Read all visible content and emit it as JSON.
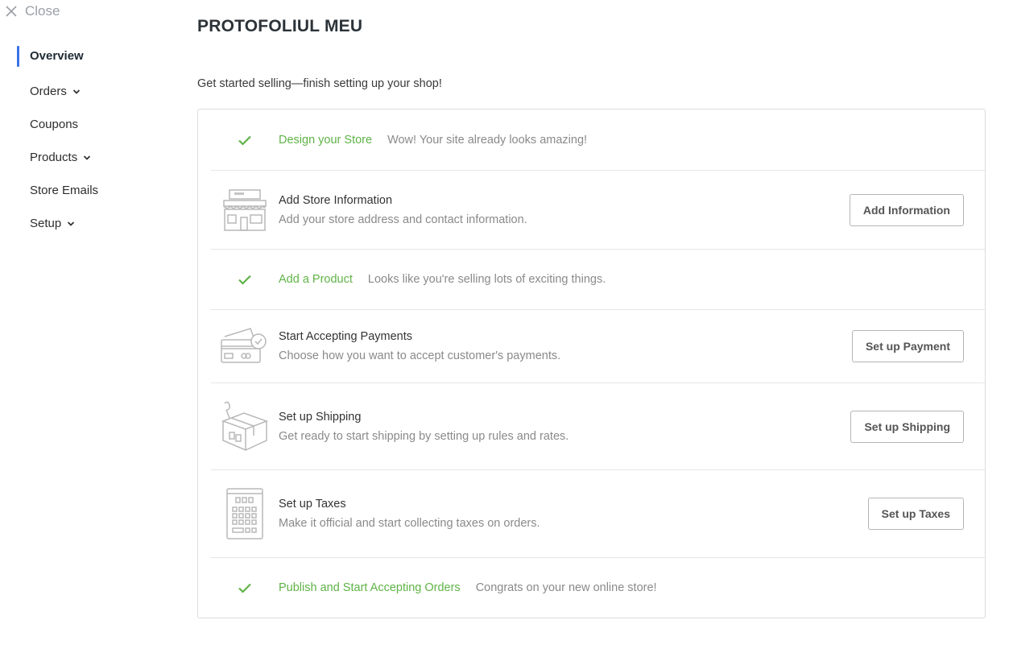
{
  "close": {
    "label": "Close"
  },
  "sidebar": {
    "items": [
      {
        "label": "Overview",
        "active": true,
        "has_chevron": false
      },
      {
        "label": "Orders",
        "active": false,
        "has_chevron": true
      },
      {
        "label": "Coupons",
        "active": false,
        "has_chevron": false
      },
      {
        "label": "Products",
        "active": false,
        "has_chevron": true
      },
      {
        "label": "Store Emails",
        "active": false,
        "has_chevron": false
      },
      {
        "label": "Setup",
        "active": false,
        "has_chevron": true
      }
    ]
  },
  "page": {
    "title": "PROTOFOLIUL MEU",
    "subtitle": "Get started selling—finish setting up your shop!"
  },
  "steps": [
    {
      "title": "Design your Store",
      "description": "Wow! Your site already looks amazing!",
      "done": true,
      "icon": "check-icon"
    },
    {
      "title": "Add Store Information",
      "description": "Add your store address and contact information.",
      "done": false,
      "icon": "storefront-icon",
      "button": "Add Information"
    },
    {
      "title": "Add a Product",
      "description": "Looks like you're selling lots of exciting things.",
      "done": true,
      "icon": "check-icon"
    },
    {
      "title": "Start Accepting Payments",
      "description": "Choose how you want to accept customer's payments.",
      "done": false,
      "icon": "credit-card-icon",
      "button": "Set up Payment"
    },
    {
      "title": "Set up Shipping",
      "description": "Get ready to start shipping by setting up rules and rates.",
      "done": false,
      "icon": "shipping-box-icon",
      "button": "Set up Shipping"
    },
    {
      "title": "Set up Taxes",
      "description": "Make it official and start collecting taxes on orders.",
      "done": false,
      "icon": "calculator-icon",
      "button": "Set up Taxes"
    },
    {
      "title": "Publish and Start Accepting Orders",
      "description": "Congrats on your new online store!",
      "done": true,
      "icon": "check-icon"
    }
  ],
  "colors": {
    "accent": "#3b73e6",
    "done_green": "#5fb347",
    "muted_text": "#8a8a8a",
    "border": "#dcdcdc"
  }
}
